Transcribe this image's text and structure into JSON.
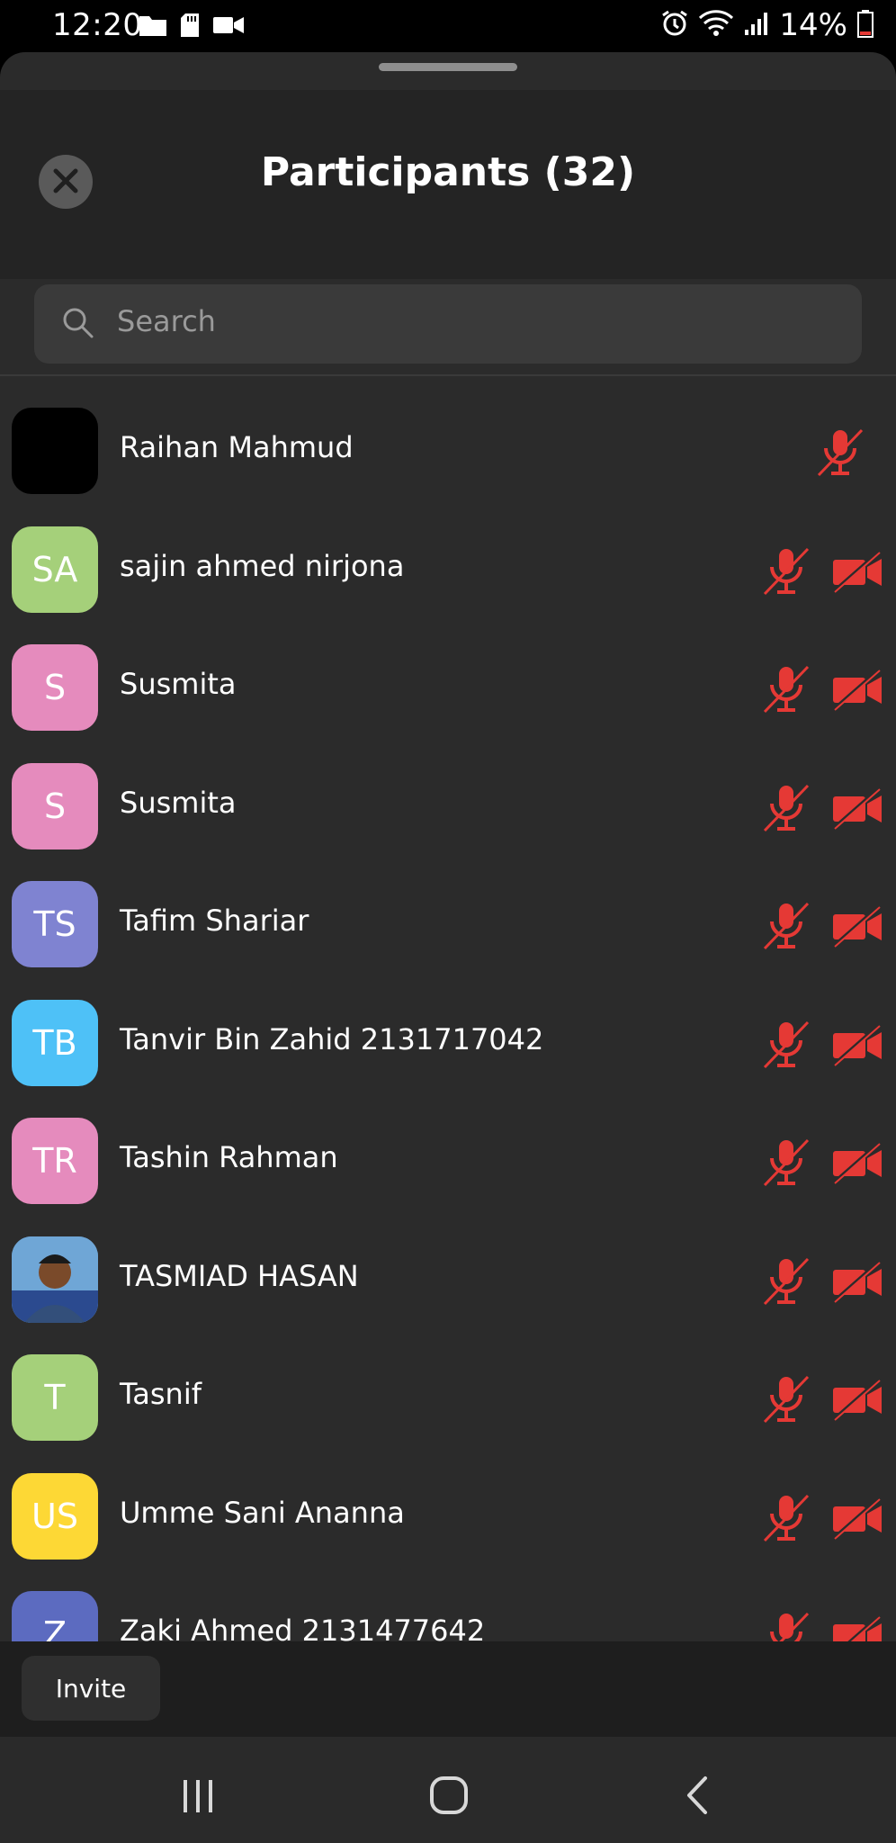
{
  "status_bar": {
    "time": "12:20",
    "battery": "14%",
    "left_icons": [
      "folder-icon",
      "sd-card-icon",
      "video-camera-icon"
    ],
    "right_icons": [
      "alarm-icon",
      "wifi-icon",
      "signal-icon",
      "battery-icon"
    ]
  },
  "header": {
    "title": "Participants (32)",
    "close_icon": "close-icon"
  },
  "search": {
    "placeholder": "Search",
    "icon": "search-icon"
  },
  "participants": [
    {
      "initials": "",
      "name": "Raihan Mahmud",
      "avatar_color": "#000000",
      "mic_muted": true,
      "video_visible": false
    },
    {
      "initials": "SA",
      "name": "sajin ahmed nirjona",
      "avatar_color": "#a5d07a",
      "mic_muted": true,
      "video_off": true
    },
    {
      "initials": "S",
      "name": "Susmita",
      "avatar_color": "#e58bbd",
      "mic_muted": true,
      "video_off": true
    },
    {
      "initials": "S",
      "name": "Susmita",
      "avatar_color": "#e58bbd",
      "mic_muted": true,
      "video_off": true
    },
    {
      "initials": "TS",
      "name": "Tafim Shariar",
      "avatar_color": "#7f83d1",
      "mic_muted": true,
      "video_off": true
    },
    {
      "initials": "TB",
      "name": "Tanvir Bin Zahid 2131717042",
      "avatar_color": "#4ec1f7",
      "mic_muted": true,
      "video_off": true
    },
    {
      "initials": "TR",
      "name": "Tashin Rahman",
      "avatar_color": "#e58bbd",
      "mic_muted": true,
      "video_off": true
    },
    {
      "initials": "",
      "name": "TASMIAD HASAN",
      "avatar_color": "#6fa6d6",
      "photo": true,
      "mic_muted": true,
      "video_off": true
    },
    {
      "initials": "T",
      "name": "Tasnif",
      "avatar_color": "#a5d07a",
      "mic_muted": true,
      "video_off": true
    },
    {
      "initials": "US",
      "name": "Umme Sani Ananna",
      "avatar_color": "#fdd835",
      "mic_muted": true,
      "video_off": true
    },
    {
      "initials": "Z",
      "name": "Zaki Ahmed 2131477642",
      "avatar_color": "#5c6bc0",
      "mic_muted": true,
      "video_off": true
    }
  ],
  "footer": {
    "invite_label": "Invite"
  },
  "colors": {
    "muted_red": "#e53935",
    "sheet_bg": "#2b2b2b"
  },
  "navigation": {
    "buttons": [
      "recents-icon",
      "home-icon",
      "back-icon"
    ]
  }
}
